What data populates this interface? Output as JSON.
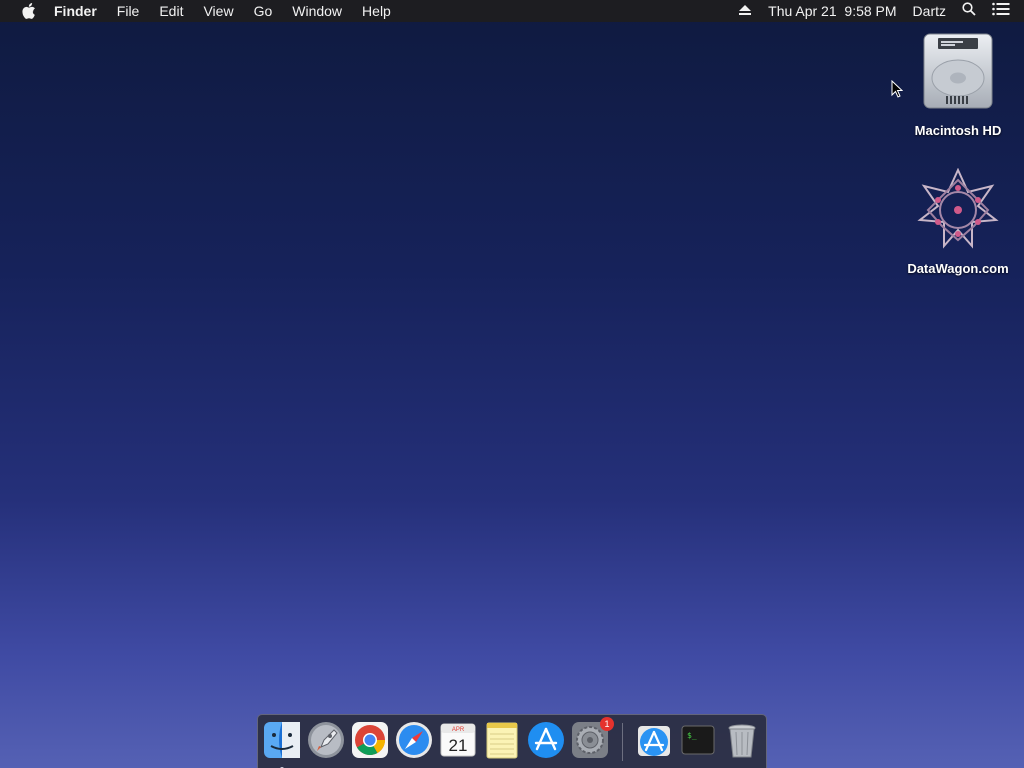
{
  "menubar": {
    "app_name": "Finder",
    "menus": [
      "File",
      "Edit",
      "View",
      "Go",
      "Window",
      "Help"
    ],
    "datetime": "Thu Apr 21  9:58 PM",
    "user": "Dartz",
    "icons": [
      "apple-icon",
      "eject-icon",
      "spotlight-search-icon",
      "notification-center-icon"
    ]
  },
  "desktop": {
    "icons": [
      {
        "label": "Macintosh HD",
        "icon": "hard-drive-icon"
      },
      {
        "label": "DataWagon.com",
        "icon": "mounted-volume-icon"
      }
    ]
  },
  "dock": {
    "apps": [
      {
        "name": "finder",
        "running": true
      },
      {
        "name": "launchpad"
      },
      {
        "name": "chrome"
      },
      {
        "name": "safari"
      },
      {
        "name": "calendar",
        "month": "APR",
        "day": "21"
      },
      {
        "name": "notes"
      },
      {
        "name": "app-store"
      },
      {
        "name": "system-preferences",
        "badge": "1"
      },
      {
        "name": "app-store-installer"
      },
      {
        "name": "terminal",
        "text": "$_"
      },
      {
        "name": "trash"
      }
    ]
  },
  "colors": {
    "menubar": "#1d1d21",
    "desktop_top": "#0f1a3f",
    "desktop_bottom": "#5561b4"
  }
}
